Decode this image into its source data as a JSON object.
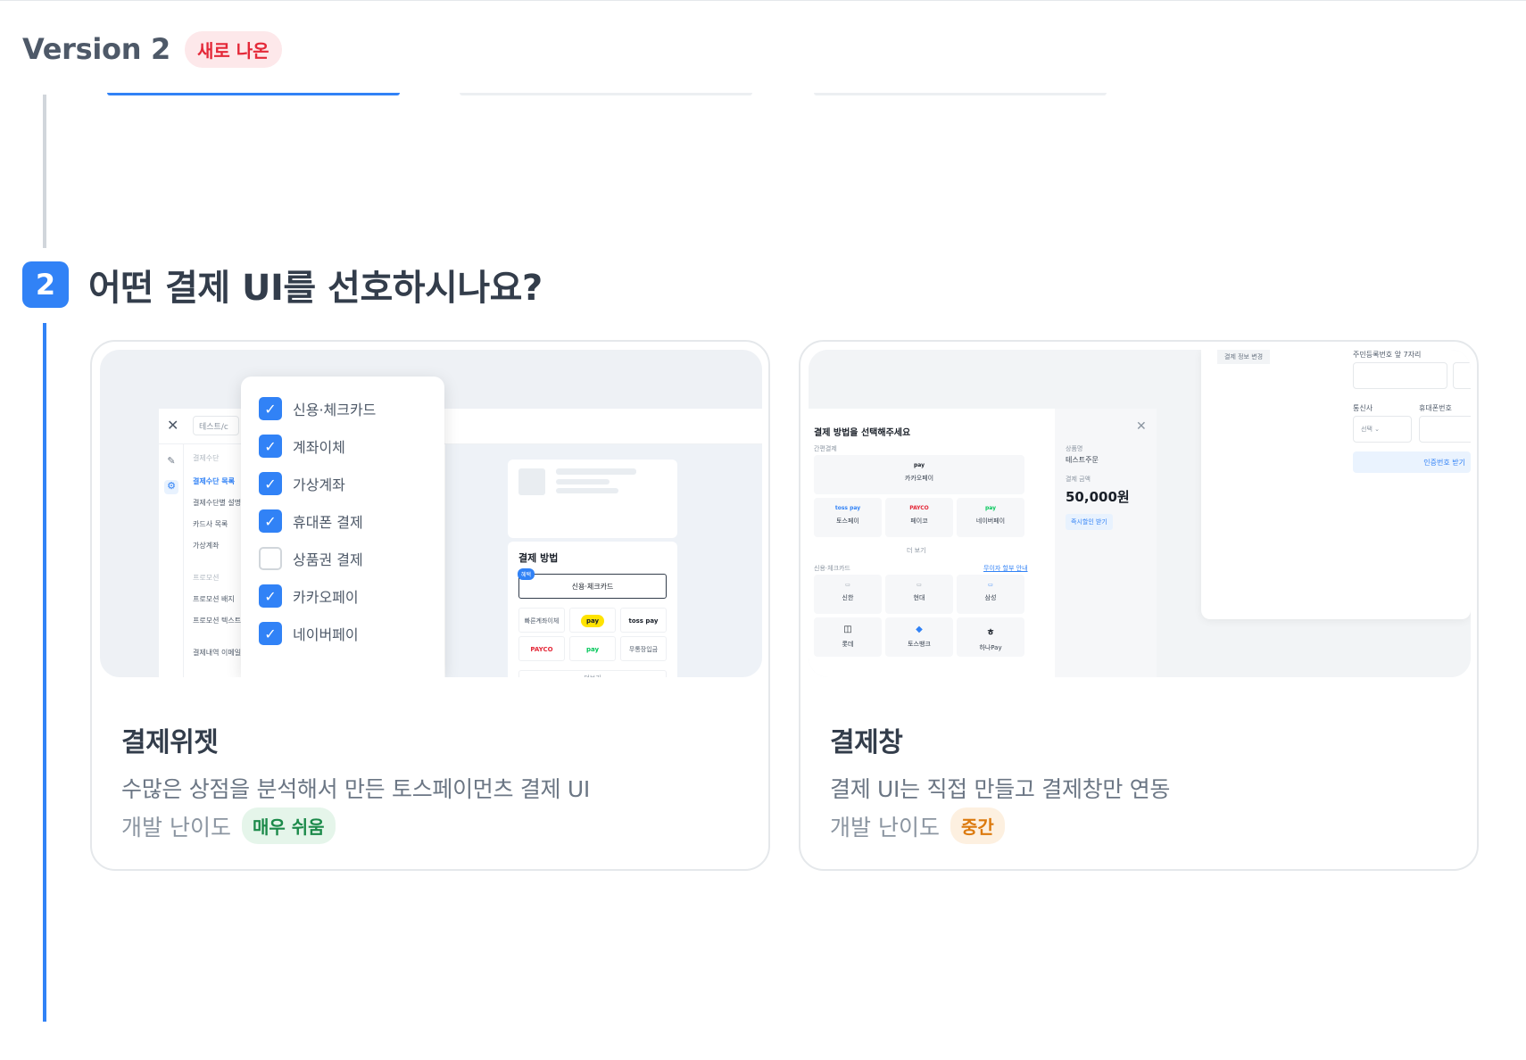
{
  "header": {
    "version_title": "Version 2",
    "new_badge": "새로 나온"
  },
  "step": {
    "number": "2",
    "question": "어떤 결제 UI를 선호하시나요?"
  },
  "options": [
    {
      "title": "결제위젯",
      "description": "수많은 상점을 분석해서 만든 토스페이먼츠 결제 UI",
      "difficulty_label": "개발 난이도",
      "difficulty_value": "매우 쉬움",
      "selected": false
    },
    {
      "title": "결제창",
      "description": "결제 UI는 직접 만들고 결제창만 연동",
      "difficulty_label": "개발 난이도",
      "difficulty_value": "중간",
      "selected": false
    }
  ],
  "widget_preview": {
    "admin_search": "테스트/c",
    "menu": [
      "결제수단",
      "결제수단 목록",
      "결제수단별 설명",
      "카드사 목록",
      "가상계좌",
      "프로모션",
      "프로모션 배지",
      "프로모션 텍스트",
      "결제내역 이메일"
    ],
    "rail_labels": [
      "디자인",
      "기능"
    ],
    "checklist": [
      {
        "label": "신용·체크카드",
        "checked": true
      },
      {
        "label": "계좌이체",
        "checked": true
      },
      {
        "label": "가상계좌",
        "checked": true
      },
      {
        "label": "휴대폰 결제",
        "checked": true
      },
      {
        "label": "상품권 결제",
        "checked": false
      },
      {
        "label": "카카오페이",
        "checked": true
      },
      {
        "label": "네이버페이",
        "checked": true
      }
    ],
    "payment_box_title": "결제 방법",
    "payment_tag": "혜택",
    "payment_selected": "신용·체크카드",
    "payment_cells": [
      "빠른계좌이체",
      "pay",
      "toss pay",
      "PAYCO",
      "pay",
      "무통장입금"
    ],
    "more_label": "더보기"
  },
  "window_preview": {
    "modal_title": "결제 방법을 선택해주세요",
    "easy_pay_label": "간편결제",
    "easy_pay": [
      {
        "logo": "pay",
        "name": "카카오페이"
      },
      {
        "logo": "toss pay",
        "name": "토스페이"
      },
      {
        "logo": "PAYCO",
        "name": "페이코"
      },
      {
        "logo": "pay",
        "name": "네이버페이"
      }
    ],
    "more_label": "더 보기",
    "card_label": "신용·체크카드",
    "card_info_link": "무이자 할부 안내",
    "cards": [
      "신한",
      "현대",
      "삼성",
      "롯데",
      "토스뱅크",
      "하나Pay"
    ],
    "side_product_label": "상품명",
    "side_product_value": "테스트주문",
    "side_amount_label": "결제 금액",
    "amount": "50,000원",
    "coupon": "즉시할인 받기",
    "form_tag": "결제 정보 변경",
    "form_id_label": "주민등록번호 앞 7자리",
    "form_carrier_label": "통신사",
    "form_phone_label": "휴대폰번호",
    "form_select": "선택",
    "form_button": "인증번호 받기"
  },
  "colors": {
    "accent": "#3182f6",
    "new_badge_bg": "#fde8ea",
    "new_badge_text": "#e42939",
    "easy_bg": "#e5f5ea",
    "easy_text": "#1c8a4a",
    "mid_bg": "#fdf0e0",
    "mid_text": "#dc7a0e"
  },
  "icons": {
    "close": "close-icon",
    "check": "checkmark-icon",
    "chevron": "chevron-down-icon"
  }
}
